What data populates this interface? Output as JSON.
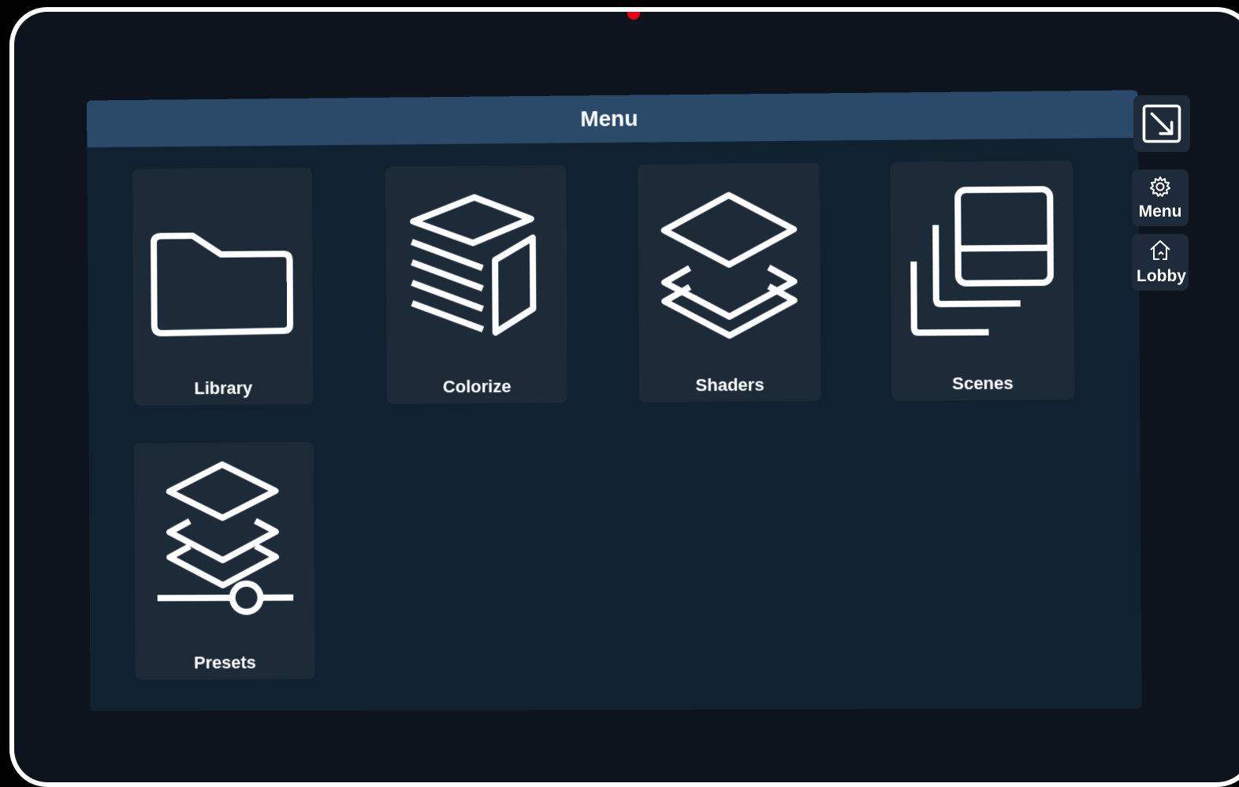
{
  "panel": {
    "title": "Menu"
  },
  "tiles": [
    {
      "label": "Library",
      "icon": "folder-icon"
    },
    {
      "label": "Colorize",
      "icon": "color-cube-icon"
    },
    {
      "label": "Shaders",
      "icon": "layers-icon"
    },
    {
      "label": "Scenes",
      "icon": "stacked-windows-icon"
    },
    {
      "label": "Presets",
      "icon": "layers-slider-icon"
    }
  ],
  "side_controls": {
    "collapse_icon": "arrow-down-right-icon",
    "menu": {
      "label": "Menu",
      "icon": "gear-icon"
    },
    "lobby": {
      "label": "Lobby",
      "icon": "home-icon"
    }
  },
  "colors": {
    "background": "#0d141d",
    "panel": "#102130",
    "header": "#2b4a69",
    "tile": "#1d2a38",
    "indicator": "#e60012"
  }
}
